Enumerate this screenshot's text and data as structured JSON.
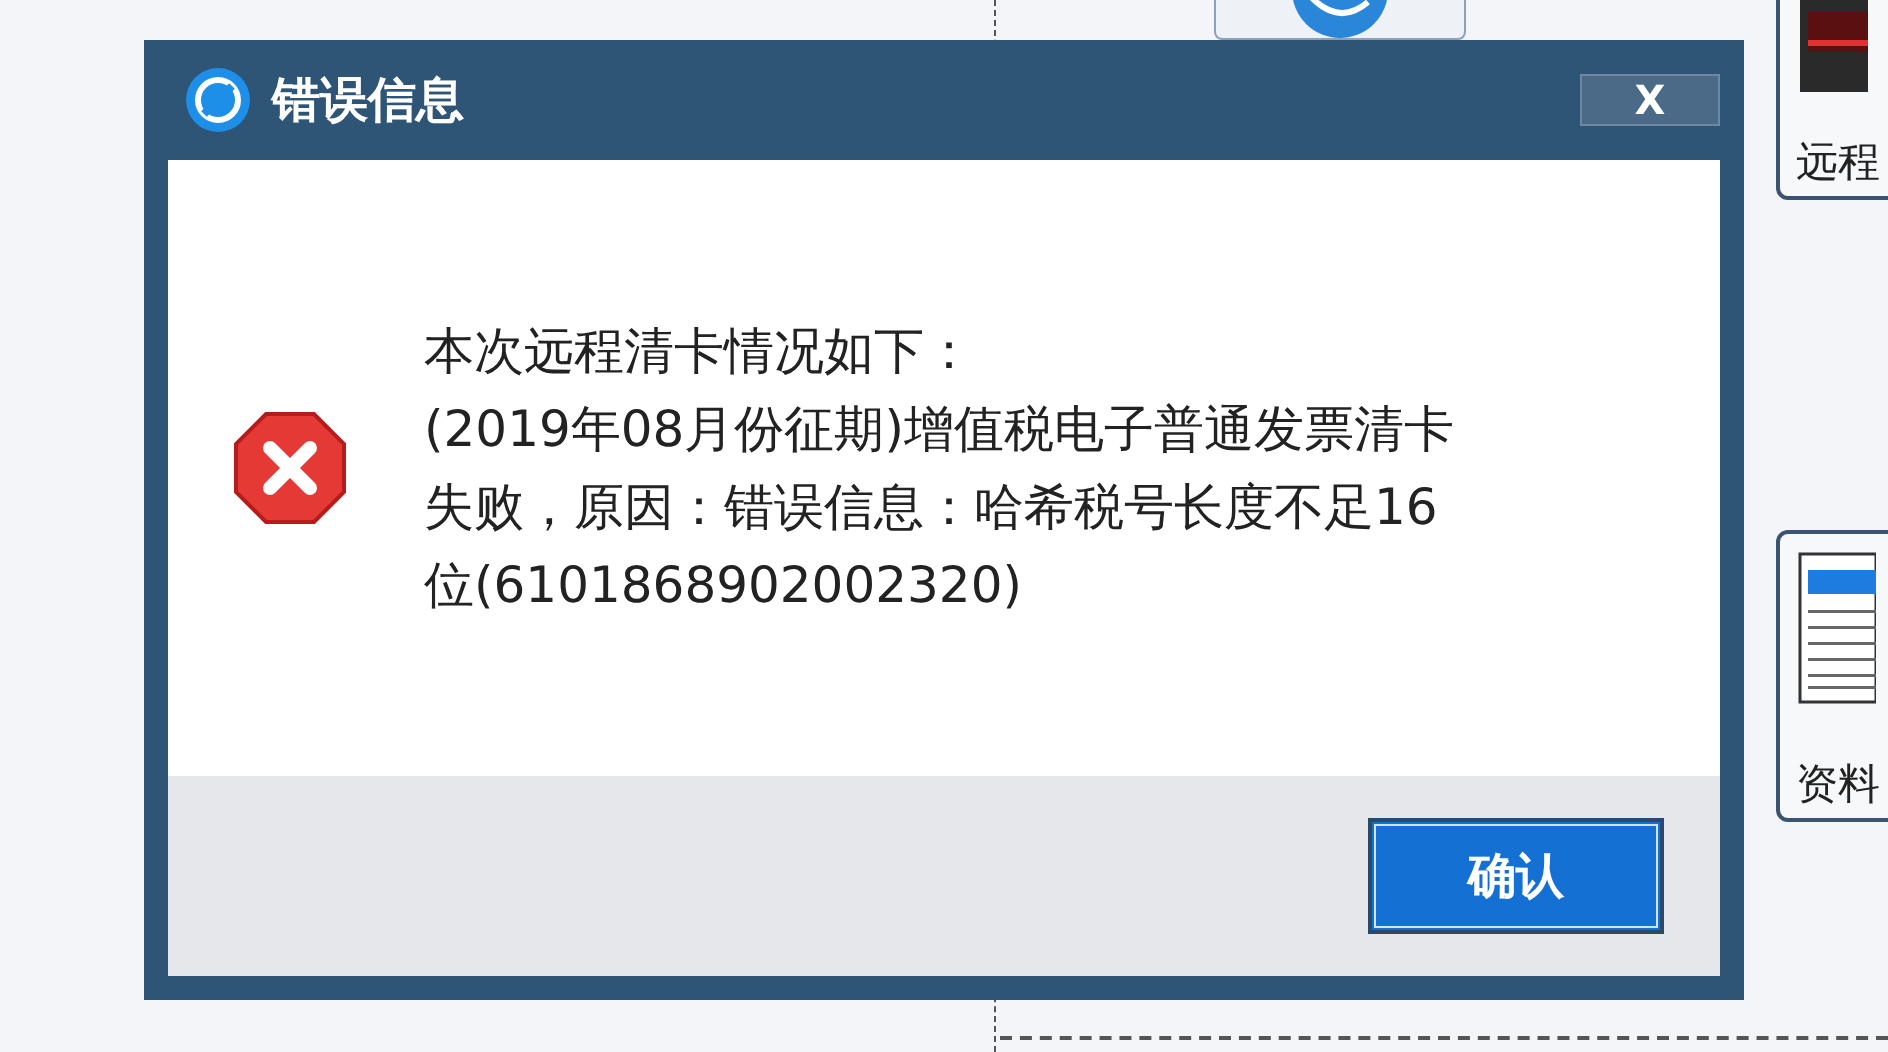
{
  "background": {
    "side_buttons": [
      {
        "label": "远程",
        "kind": "monitor"
      },
      {
        "label": "资料",
        "kind": "document"
      }
    ]
  },
  "dialog": {
    "title": "错误信息",
    "close": "X",
    "message_lines": [
      "本次远程清卡情况如下：",
      "(2019年08月份征期)增值税电子普通发票清卡",
      "失败，原因：错误信息：哈希税号长度不足16",
      "位(6101868902002320)"
    ],
    "confirm": "确认"
  }
}
